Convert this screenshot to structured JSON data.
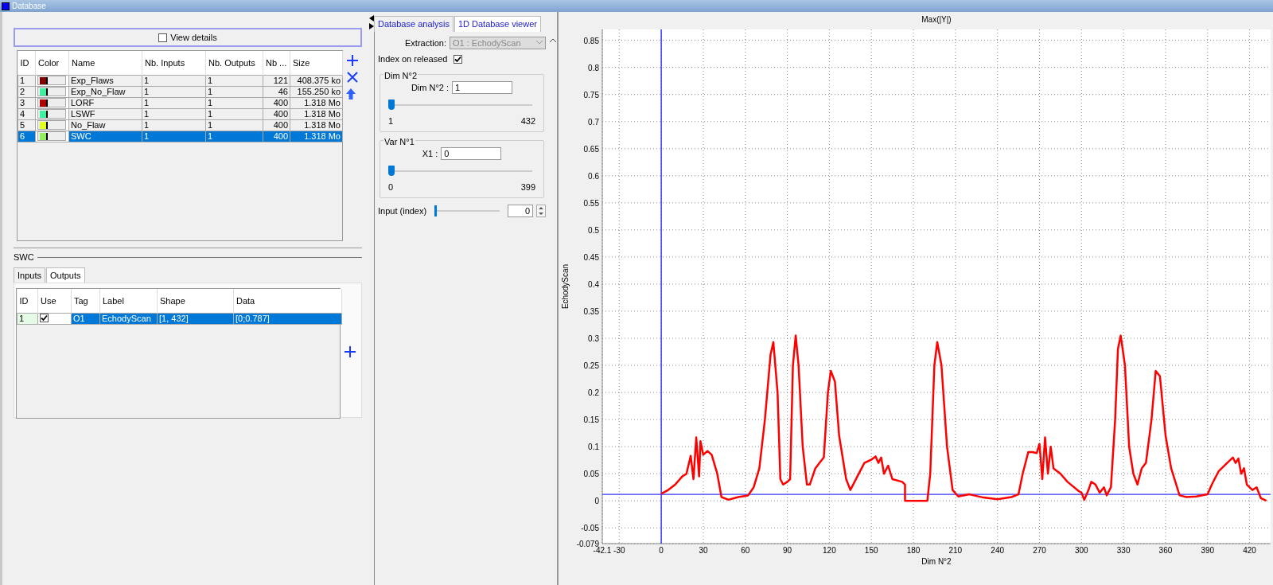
{
  "window": {
    "title": "Database"
  },
  "database": {
    "view_details": {
      "label": "View details",
      "checked": false
    },
    "columns": [
      "ID",
      "Color",
      "Name",
      "Nb. Inputs",
      "Nb. Outputs",
      "Nb ...",
      "Size"
    ],
    "rows": [
      {
        "id": "1",
        "color": "#7f0000",
        "name": "Exp_Flaws",
        "inputs": "1",
        "outputs": "1",
        "nb": "121",
        "size": "408.375 ko",
        "selected": false
      },
      {
        "id": "2",
        "color": "#40f0a0",
        "name": "Exp_No_Flaw",
        "inputs": "1",
        "outputs": "1",
        "nb": "46",
        "size": "155.250 ko",
        "selected": false
      },
      {
        "id": "3",
        "color": "#b00000",
        "name": "LORF",
        "inputs": "1",
        "outputs": "1",
        "nb": "400",
        "size": "1.318 Mo",
        "selected": false
      },
      {
        "id": "4",
        "color": "#40f0a0",
        "name": "LSWF",
        "inputs": "1",
        "outputs": "1",
        "nb": "400",
        "size": "1.318 Mo",
        "selected": false
      },
      {
        "id": "5",
        "color": "#e0ff20",
        "name": "No_Flaw",
        "inputs": "1",
        "outputs": "1",
        "nb": "400",
        "size": "1.318 Mo",
        "selected": false
      },
      {
        "id": "6",
        "color": "#90f060",
        "name": "SWC",
        "inputs": "1",
        "outputs": "1",
        "nb": "400",
        "size": "1.318 Mo",
        "selected": true
      }
    ]
  },
  "detail": {
    "title": "SWC",
    "tabs": [
      {
        "label": "Inputs",
        "selected": false
      },
      {
        "label": "Outputs",
        "selected": true
      }
    ],
    "columns": [
      "ID",
      "Use",
      "Tag",
      "Label",
      "Shape",
      "Data"
    ],
    "rows": [
      {
        "id": "1",
        "use": true,
        "tag": "O1",
        "label": "EchodyScan",
        "shape": "[1, 432]",
        "data": "[0;0.787]",
        "selected": true
      }
    ]
  },
  "viewer": {
    "tabs": [
      {
        "label": "Database analysis",
        "selected": false
      },
      {
        "label": "1D Database viewer",
        "selected": true
      }
    ],
    "extraction": {
      "label": "Extraction:",
      "value": "O1 : EchodyScan",
      "disabled": true
    },
    "index_on_released": {
      "label": "Index on released",
      "checked": true
    },
    "groups": [
      {
        "title": "Dim N°2",
        "field_label": "Dim N°2 :",
        "value": "1",
        "level": 0,
        "min": "1",
        "max": "432"
      },
      {
        "title": "Var N°1",
        "field_label": "X1 :",
        "value": "0",
        "level": 0,
        "min": "0",
        "max": "399"
      }
    ],
    "input_index": {
      "label": "Input (index)",
      "level": 0,
      "value": "0"
    }
  },
  "chart": {
    "chart_data": {
      "type": "line",
      "title": "Max(|Y|)",
      "xlabel": "Dim N°2",
      "ylabel": "EchodyScan",
      "x": [
        0,
        5,
        10,
        15,
        18,
        21,
        23,
        25,
        27,
        28,
        30,
        33,
        36,
        40,
        43,
        48,
        55,
        62,
        66,
        70,
        74,
        78,
        80,
        83,
        85,
        87,
        90,
        92,
        94,
        96,
        98,
        101,
        104,
        106,
        110,
        113,
        116,
        119,
        121,
        124,
        127,
        132,
        135,
        140,
        145,
        150,
        153,
        155,
        157,
        159,
        162,
        165,
        172,
        174,
        174,
        190,
        192,
        195,
        197,
        200,
        204,
        208,
        212,
        220,
        230,
        240,
        250,
        255,
        258,
        262,
        265,
        268,
        270,
        272,
        274,
        276,
        278,
        280,
        285,
        290,
        298,
        300,
        302,
        305,
        307,
        310,
        313,
        316,
        318,
        321,
        324,
        326,
        328,
        331,
        334,
        337,
        340,
        343,
        346,
        350,
        353,
        356,
        360,
        364,
        370,
        375,
        382,
        390,
        393,
        398,
        404,
        408,
        410,
        412,
        414,
        416,
        418,
        422,
        425,
        428,
        432
      ],
      "grid": true,
      "ref_lines": [
        {
          "axis": "y",
          "value": 0.012,
          "color": "#3a3aff"
        },
        {
          "axis": "x",
          "value": 0,
          "color": "#3a3aff"
        }
      ],
      "series": [
        {
          "color": "#ff0000",
          "values": [
            0.013,
            0.02,
            0.03,
            0.045,
            0.05,
            0.083,
            0.04,
            0.117,
            0.045,
            0.11,
            0.085,
            0.092,
            0.085,
            0.05,
            0.007,
            0.002,
            0.007,
            0.01,
            0.025,
            0.06,
            0.15,
            0.27,
            0.293,
            0.2,
            0.04,
            0.03,
            0.035,
            0.04,
            0.25,
            0.305,
            0.25,
            0.1,
            0.03,
            0.03,
            0.06,
            0.07,
            0.08,
            0.2,
            0.24,
            0.22,
            0.12,
            0.04,
            0.02,
            0.045,
            0.07,
            0.076,
            0.082,
            0.07,
            0.08,
            0.05,
            0.065,
            0.04,
            0.035,
            0.03,
            0,
            0,
            0.05,
            0.25,
            0.293,
            0.25,
            0.1,
            0.02,
            0.008,
            0.012,
            0.006,
            0.003,
            0.007,
            0.012,
            0.05,
            0.09,
            0.09,
            0.088,
            0.105,
            0.04,
            0.117,
            0.05,
            0.1,
            0.06,
            0.05,
            0.035,
            0.018,
            0.015,
            0.002,
            0.02,
            0.035,
            0.03,
            0.015,
            0.025,
            0.01,
            0.025,
            0.15,
            0.28,
            0.305,
            0.25,
            0.1,
            0.05,
            0.03,
            0.06,
            0.07,
            0.15,
            0.24,
            0.23,
            0.12,
            0.06,
            0.01,
            0.007,
            0.008,
            0.012,
            0.03,
            0.055,
            0.07,
            0.08,
            0.07,
            0.078,
            0.05,
            0.06,
            0.03,
            0.02,
            0.025,
            0.005,
            0
          ]
        }
      ],
      "xlim": [
        -42.1,
        435
      ],
      "ylim": [
        -0.079,
        0.87
      ],
      "xticks": [
        -42.1,
        -30,
        0,
        30,
        60,
        90,
        120,
        150,
        180,
        210,
        240,
        270,
        300,
        330,
        360,
        390,
        420
      ],
      "yticks": [
        -0.079,
        -0.05,
        0,
        0.05,
        0.1,
        0.15,
        0.2,
        0.25,
        0.3,
        0.35,
        0.4,
        0.45,
        0.5,
        0.55,
        0.6,
        0.65,
        0.7,
        0.75,
        0.8,
        0.85
      ]
    }
  }
}
